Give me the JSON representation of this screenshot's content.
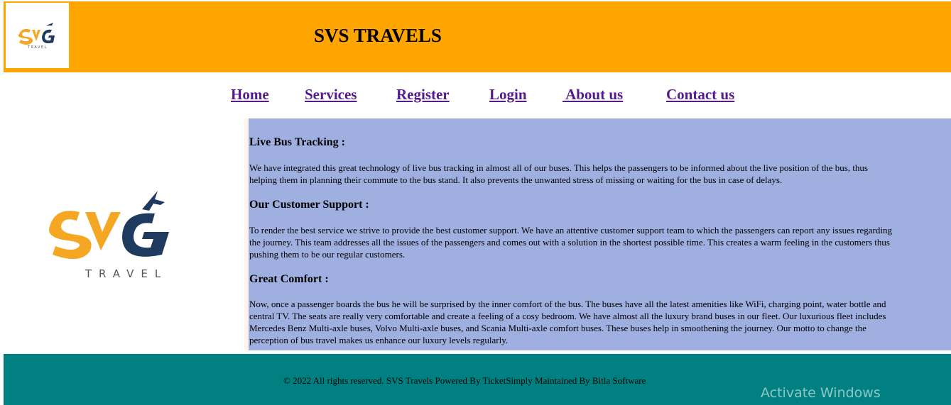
{
  "header": {
    "title": "SVS TRAVELS",
    "logo_text": "TRAVEL"
  },
  "nav": {
    "items": [
      "Home",
      "Services",
      "Register",
      "Login",
      " About us",
      "Contact us"
    ]
  },
  "sections": [
    {
      "heading": "Live Bus Tracking :",
      "lines": [
        "We have integrated this great technology of live bus tracking in almost all of our buses. This helps the passengers to be informed about the live position of the bus, thus",
        "helping them in planning their commute to the bus stand. It also prevents the unwanted stress of missing or waiting for the bus in case of delays."
      ]
    },
    {
      "heading": "Our Customer Support :",
      "lines": [
        "To render the best service we strive to provide the best customer support. We have an attentive customer support team to which the passengers can report any issues regarding",
        "the journey. This team addresses all the issues of the passengers and comes out with a solution in the shortest possible time. This creates a warm feeling in the customers thus",
        "pushing them to be our regular customers."
      ]
    },
    {
      "heading": "Great Comfort :",
      "lines": [
        "Now, once a passenger boards the bus he will be surprised by the inner comfort of the bus. The buses have all the latest amenities like WiFi, charging point, water bottle and",
        "central TV. The seats are really very comfortable and create a feeling of a cosy bedroom. We have almost all the luxury brand buses in our fleet. Our luxurious fleet includes",
        "Mercedes Benz Multi-axle buses, Volvo Multi-axle buses, and Scania Multi-axle comfort buses. These buses help in smoothening the journey. Our motto to change the",
        "perception of bus travel makes us enhance our luxury levels regularly."
      ]
    }
  ],
  "footer": {
    "text": "© 2022 All rights reserved. SVS Travels Powered By TicketSimply Maintained By Bitla Software"
  },
  "watermark": "Activate Windows",
  "colors": {
    "header_bg": "#ffa500",
    "info_bg": "#9fb0e0",
    "footer_bg": "#008080",
    "link": "#551a8b",
    "logo_orange": "#f5a623",
    "logo_navy": "#1e3a5f"
  }
}
